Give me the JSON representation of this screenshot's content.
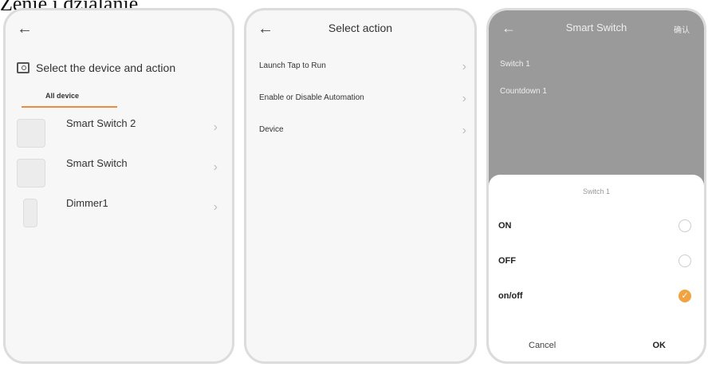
{
  "caption": "Zenie i dzialanie.",
  "screen1": {
    "title": "Select the device and action",
    "tab": "All device",
    "devices": [
      {
        "name": "Smart Switch 2"
      },
      {
        "name": "Smart Switch"
      },
      {
        "name": "Dimmer1"
      }
    ]
  },
  "screen2": {
    "title": "Select action",
    "actions": [
      {
        "label": "Launch Tap to Run"
      },
      {
        "label": "Enable or Disable Automation"
      },
      {
        "label": "Device"
      }
    ]
  },
  "screen3": {
    "title": "Smart Switch",
    "confirm_label": "确认",
    "rows": [
      "Switch 1",
      "Countdown 1"
    ],
    "sheet": {
      "title": "Switch 1",
      "options": [
        {
          "label": "ON",
          "selected": false
        },
        {
          "label": "OFF",
          "selected": false
        },
        {
          "label": "on/off",
          "selected": true
        }
      ],
      "cancel_label": "Cancel",
      "ok_label": "OK"
    }
  },
  "colors": {
    "accent": "#f08a3c",
    "selected": "#f0a340"
  },
  "icons": {
    "back": "back-arrow-icon",
    "chevron": "chevron-right-icon",
    "check": "check-icon"
  }
}
